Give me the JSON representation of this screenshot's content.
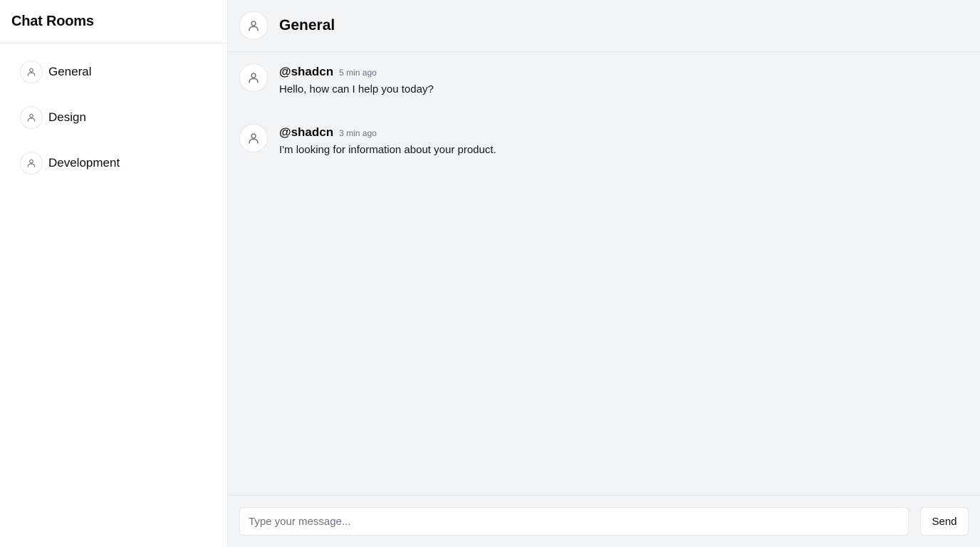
{
  "sidebar": {
    "title": "Chat Rooms",
    "rooms": [
      {
        "label": "General",
        "icon": "user-icon"
      },
      {
        "label": "Design",
        "icon": "user-icon"
      },
      {
        "label": "Development",
        "icon": "user-icon"
      }
    ]
  },
  "chat": {
    "title": "General",
    "icon": "user-icon",
    "messages": [
      {
        "author": "@shadcn",
        "time": "5 min ago",
        "text": "Hello, how can I help you today?"
      },
      {
        "author": "@shadcn",
        "time": "3 min ago",
        "text": "I'm looking for information about your product."
      }
    ]
  },
  "composer": {
    "placeholder": "Type your message...",
    "value": "",
    "send_label": "Send"
  },
  "colors": {
    "sidebar_bg": "#ffffff",
    "main_bg": "#f1f3f5",
    "border": "#e5e7eb",
    "muted_text": "#6b7280"
  }
}
